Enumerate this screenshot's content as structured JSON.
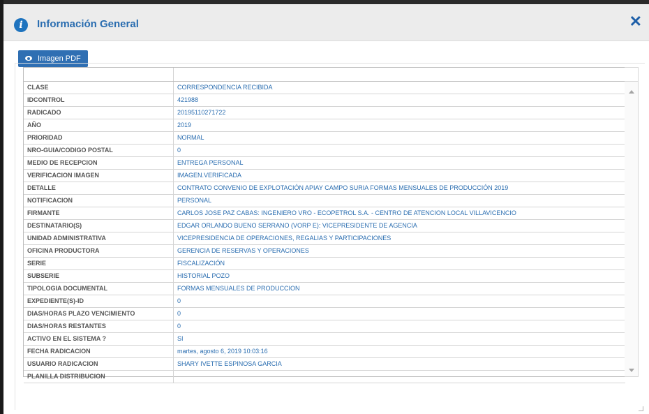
{
  "dialog": {
    "title": "Información General",
    "close_icon": "close-icon",
    "info_icon": "info-icon",
    "accent_color": "#2a6db0"
  },
  "toolbar": {
    "pdf_label": "Imagen PDF",
    "pdf_icon": "eye-icon"
  },
  "rows": [
    {
      "key": "CLASE",
      "value": "CORRESPONDENCIA RECIBIDA"
    },
    {
      "key": "IDCONTROL",
      "value": "421988"
    },
    {
      "key": "RADICADO",
      "value": "20195110271722"
    },
    {
      "key": "AÑO",
      "value": "2019"
    },
    {
      "key": "PRIORIDAD",
      "value": "NORMAL"
    },
    {
      "key": "NRO-GUIA/CODIGO POSTAL",
      "value": "0"
    },
    {
      "key": "MEDIO DE RECEPCION",
      "value": "ENTREGA PERSONAL"
    },
    {
      "key": "VERIFICACION IMAGEN",
      "value": "IMAGEN.VERIFICADA"
    },
    {
      "key": "DETALLE",
      "value": "CONTRATO CONVENIO DE EXPLOTACIÓN APIAY CAMPO SURIA FORMAS MENSUALES DE PRODUCCIÓN 2019"
    },
    {
      "key": "NOTIFICACION",
      "value": "PERSONAL"
    },
    {
      "key": "FIRMANTE",
      "value": "CARLOS JOSE PAZ CABAS: INGENIERO VRO - ECOPETROL S.A. - CENTRO DE ATENCION LOCAL VILLAVICENCIO"
    },
    {
      "key": "DESTINATARIO(S)",
      "value": "EDGAR ORLANDO BUENO SERRANO (VORP E): VICEPRESIDENTE DE AGENCIA"
    },
    {
      "key": "UNIDAD ADMINISTRATIVA",
      "value": "VICEPRESIDENCIA DE OPERACIONES, REGALIAS Y PARTICIPACIONES"
    },
    {
      "key": "OFICINA PRODUCTORA",
      "value": "GERENCIA DE RESERVAS Y OPERACIONES"
    },
    {
      "key": "SERIE",
      "value": "FISCALIZACIÓN"
    },
    {
      "key": "SUBSERIE",
      "value": "HISTORIAL POZO"
    },
    {
      "key": "TIPOLOGIA DOCUMENTAL",
      "value": "FORMAS MENSUALES DE PRODUCCION"
    },
    {
      "key": "EXPEDIENTE(S)-ID",
      "value": "0"
    },
    {
      "key": "DIAS/HORAS PLAZO VENCIMIENTO",
      "value": "0"
    },
    {
      "key": "DIAS/HORAS RESTANTES",
      "value": "0"
    },
    {
      "key": "ACTIVO EN EL SISTEMA ?",
      "value": "SI"
    },
    {
      "key": "FECHA RADICACION",
      "value": "martes, agosto 6, 2019 10:03:16"
    },
    {
      "key": "USUARIO RADICACION",
      "value": "SHARY IVETTE ESPINOSA GARCIA"
    },
    {
      "key": "PLANILLA DISTRIBUCION",
      "value": ""
    }
  ]
}
